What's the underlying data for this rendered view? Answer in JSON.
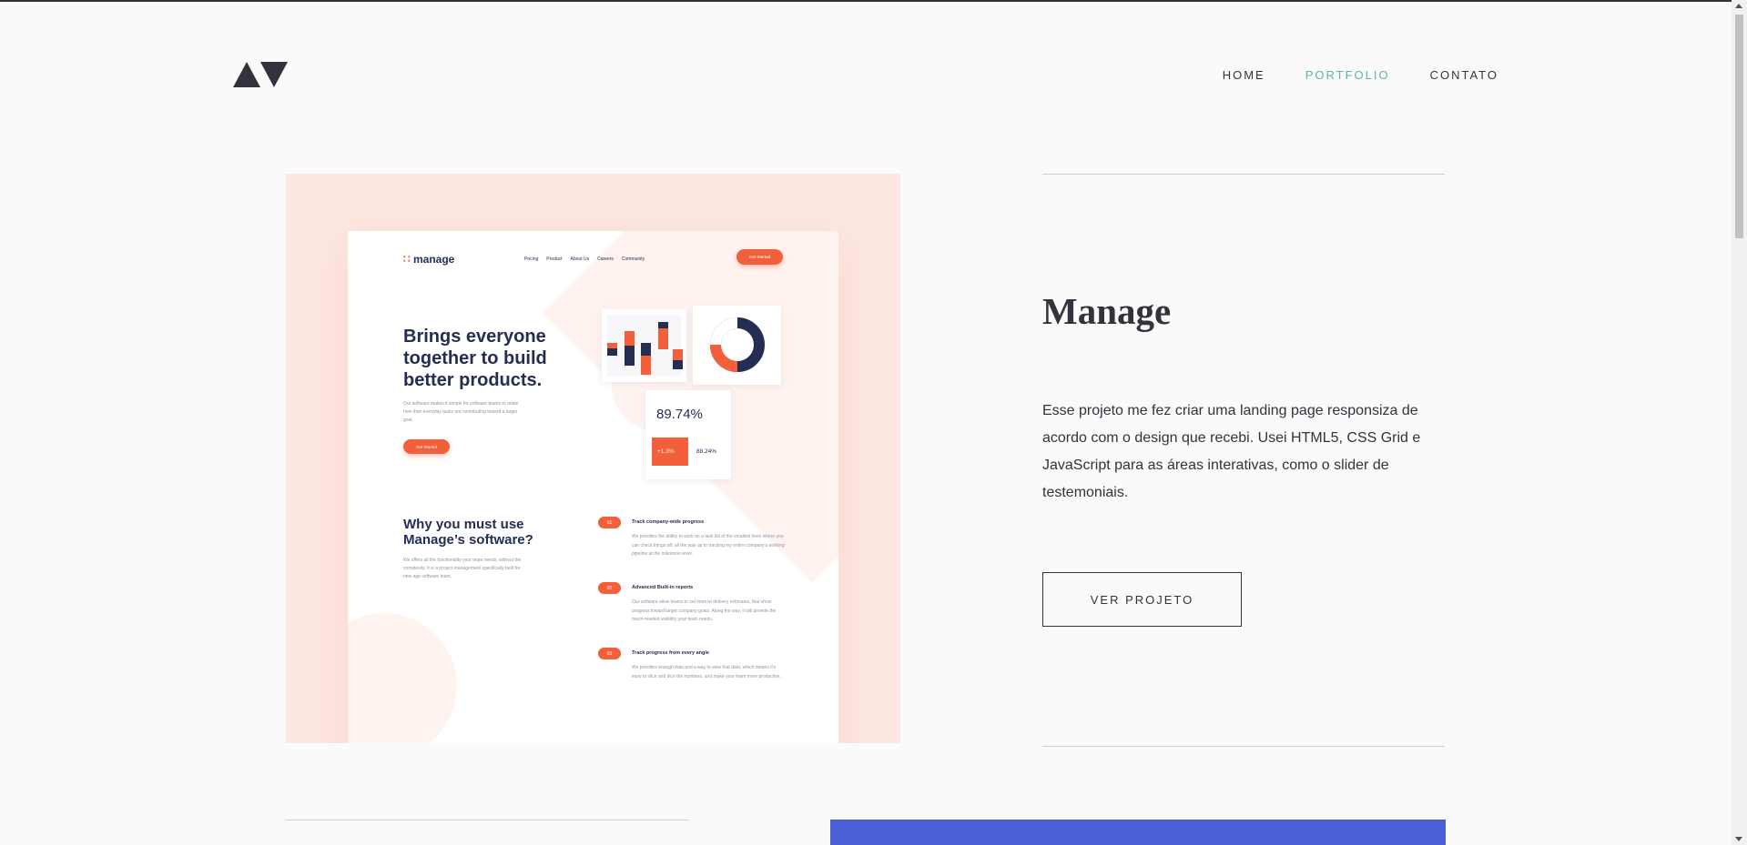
{
  "nav": {
    "home": "HOME",
    "portfolio": "PORTFOLIO",
    "contact": "CONTATO",
    "active_color": "#5fb4a2"
  },
  "logo": {
    "icon": "triangles-logo-icon"
  },
  "project": {
    "title": "Manage",
    "description": "Esse projeto me fez criar uma landing page responsiza de acordo com o design que recebi. Usei HTML5, CSS Grid e JavaScript para as áreas interativas, como o slider de testemoniais.",
    "cta_label": "VER PROJETO"
  },
  "preview": {
    "logo": "manage",
    "nav": [
      "Pricing",
      "Product",
      "About Us",
      "Careers",
      "Community"
    ],
    "get_started": "Get Started",
    "hero_title": "Brings everyone together to build better products.",
    "hero_text": "Our software makes it simple for software teams to relate how their everyday tasks are contributing toward a larger goal.",
    "why_title": "Why you must use Manage’s software?",
    "why_text": "We offers all the functionality your team needs, without the complexity. It is a project management specifically built for new age software team.",
    "stat_main": "89.74%",
    "stat_up": "+1.3%",
    "stat_small": "88.24%",
    "features": [
      {
        "num": "01",
        "title": "Track company-wide progress",
        "text": "We provides the ability to work on a task list of the smallest level where you can check things off, all the way up to tracking my entire company's working pipeline at the milestone level."
      },
      {
        "num": "02",
        "title": "Advanced Built-in reports",
        "text": "Our software allow teams to set internal delivery estimates, that show progress toward larger company goals. Along the way, it will provide the much-needed visibility your team needs."
      },
      {
        "num": "03",
        "title": "Track progress from every angle",
        "text": "We provides enough data and a way to view that data, which means it's easy to slice and dice the numbers, and make your team more productive."
      }
    ],
    "colors": {
      "accent": "#f25f3a",
      "navy": "#242d52",
      "bg": "#fde7e2"
    }
  },
  "next_section": {
    "color": "#4a5fd6"
  }
}
